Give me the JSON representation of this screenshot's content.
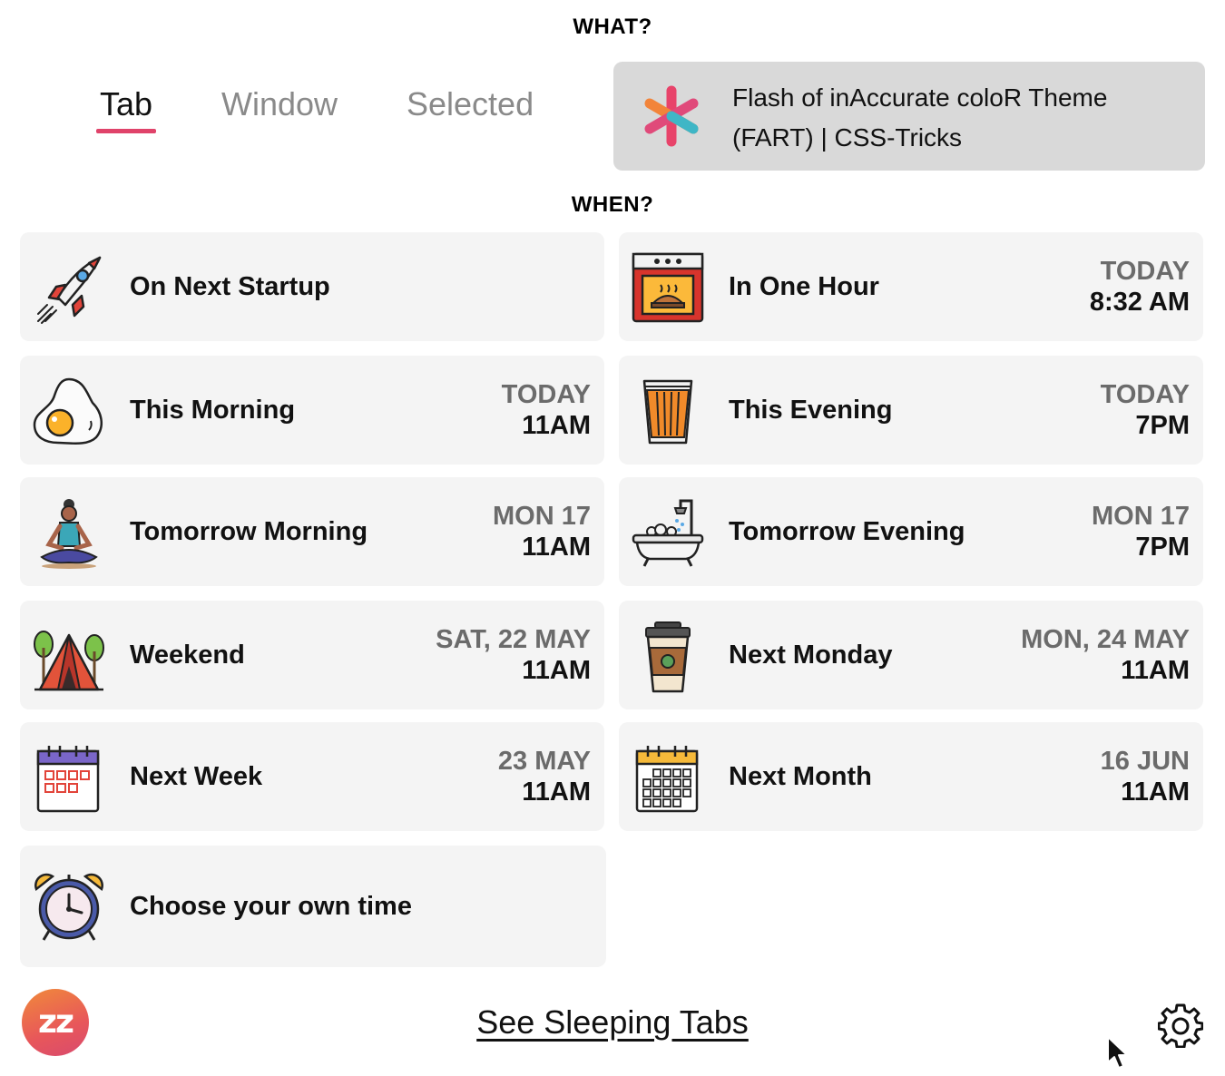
{
  "what": {
    "heading": "WHAT?"
  },
  "tabs": [
    {
      "label": "Tab",
      "active": true
    },
    {
      "label": "Window",
      "active": false
    },
    {
      "label": "Selected",
      "active": false
    }
  ],
  "selected_page": {
    "title": "Flash of inAccurate coloR Theme (FART) | CSS-Tricks",
    "icon": "asterisk-favicon-icon"
  },
  "when": {
    "heading": "WHEN?"
  },
  "options": [
    {
      "label": "On Next Startup",
      "day": "",
      "time": "",
      "icon": "rocket-icon"
    },
    {
      "label": "In One Hour",
      "day": "TODAY",
      "time": "8:32 AM",
      "icon": "oven-icon"
    },
    {
      "label": "This Morning",
      "day": "TODAY",
      "time": "11AM",
      "icon": "fried-egg-icon"
    },
    {
      "label": "This Evening",
      "day": "TODAY",
      "time": "7PM",
      "icon": "beer-glass-icon"
    },
    {
      "label": "Tomorrow Morning",
      "day": "MON 17",
      "time": "11AM",
      "icon": "yoga-person-icon"
    },
    {
      "label": "Tomorrow Evening",
      "day": "MON 17",
      "time": "7PM",
      "icon": "bathtub-icon"
    },
    {
      "label": "Weekend",
      "day": "SAT, 22 MAY",
      "time": "11AM",
      "icon": "tent-icon"
    },
    {
      "label": "Next Monday",
      "day": "MON, 24 MAY",
      "time": "11AM",
      "icon": "coffee-cup-icon"
    },
    {
      "label": "Next Week",
      "day": "23 MAY",
      "time": "11AM",
      "icon": "week-calendar-icon"
    },
    {
      "label": "Next Month",
      "day": "16 JUN",
      "time": "11AM",
      "icon": "month-calendar-icon"
    },
    {
      "label": "Choose your own time",
      "day": "",
      "time": "",
      "icon": "alarm-clock-icon"
    }
  ],
  "footer": {
    "logo_text": "zz",
    "link_label": "See Sleeping Tabs",
    "settings_icon": "gear-icon"
  },
  "colors": {
    "accent": "#e0436a",
    "card_bg": "#f4f4f4",
    "selected_card_bg": "#d9d9d9"
  }
}
